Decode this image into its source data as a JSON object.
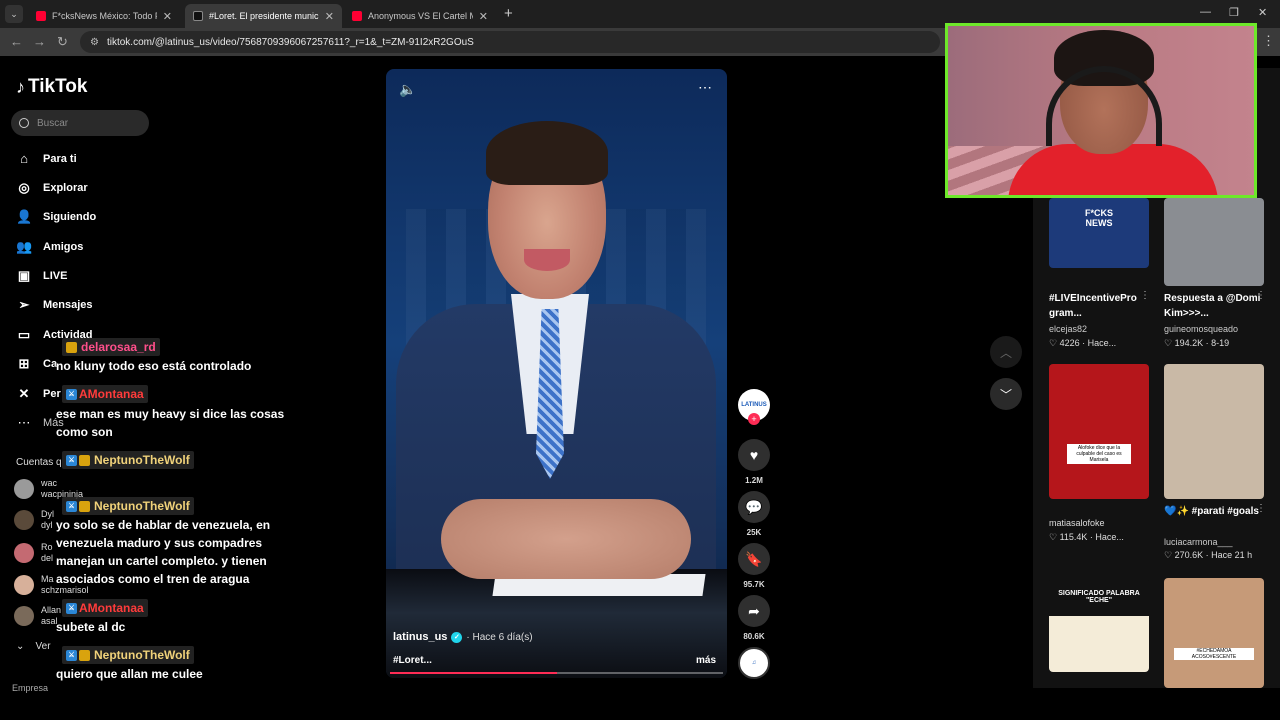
{
  "browser": {
    "tabs": [
      {
        "title": "F*cksNews México: Todo Por Un",
        "favicon_color": "#ff0033",
        "active": false
      },
      {
        "title": "#Loret. El presidente municipal",
        "favicon_color": "#111111",
        "active": true
      },
      {
        "title": "Anonymous VS El Cartel Más Pe",
        "favicon_color": "#ff0033",
        "active": false
      }
    ],
    "new_tab": "+",
    "url": "tiktok.com/@latinus_us/video/7568709396067257611?_r=1&_t=ZM-91I2xR2GOuS"
  },
  "tiktok": {
    "logo": "TikTok",
    "search_placeholder": "Buscar",
    "nav": [
      {
        "label": "Para ti",
        "icon": "home-icon"
      },
      {
        "label": "Explorar",
        "icon": "compass-icon"
      },
      {
        "label": "Siguiendo",
        "icon": "following-icon"
      },
      {
        "label": "Amigos",
        "icon": "friends-icon"
      },
      {
        "label": "LIVE",
        "icon": "live-icon"
      },
      {
        "label": "Mensajes",
        "icon": "messages-icon"
      },
      {
        "label": "Actividad",
        "icon": "activity-icon"
      },
      {
        "label": "Ca",
        "icon": "upload-icon"
      },
      {
        "label": "Per",
        "icon": "profile-icon"
      },
      {
        "label": "Más",
        "icon": "more-icon"
      }
    ],
    "accounts_title": "Cuentas q",
    "accounts": [
      {
        "name": "wac",
        "sub": "wacpininja"
      },
      {
        "name": "Dyl",
        "sub": "dyl"
      },
      {
        "name": "Ro",
        "sub": "del"
      },
      {
        "name": "Ma",
        "sub": "schzmarisol"
      },
      {
        "name": "Allan",
        "sub": "asal"
      }
    ],
    "see_more": "Ver",
    "footer": "Empresa"
  },
  "chat": [
    {
      "user": "delarosaa_rd",
      "user_color": "#ff4f8b",
      "msg": "no kluny todo eso está controlado"
    },
    {
      "user": "AMontanaa",
      "user_color": "#ff3b3b",
      "msg": "ese man es muy heavy si dice las cosas como son"
    },
    {
      "user": "NeptunoTheWolf",
      "user_color": "#f0d27a",
      "msg": ""
    },
    {
      "user": "NeptunoTheWolf",
      "user_color": "#f0d27a",
      "msg": "yo solo se de hablar de venezuela, en venezuela maduro y sus compadres manejan un cartel completo. y tienen asociados como el tren de aragua"
    },
    {
      "user": "AMontanaa",
      "user_color": "#ff3b3b",
      "msg": "subete al dc"
    },
    {
      "user": "NeptunoTheWolf",
      "user_color": "#f0d27a",
      "msg": "quiero que allan me culee"
    }
  ],
  "video": {
    "author": "latinus_us",
    "time": "· Hace 6 día(s)",
    "caption": "#Loret...",
    "more": "más",
    "progress": 0.5,
    "actions": [
      {
        "name": "like",
        "icon": "heart-icon",
        "count": "1.2M"
      },
      {
        "name": "comment",
        "icon": "comment-icon",
        "count": "25K"
      },
      {
        "name": "bookmark",
        "icon": "bookmark-icon",
        "count": "95.7K"
      },
      {
        "name": "share",
        "icon": "share-icon",
        "count": "80.6K"
      }
    ],
    "avatar_text": "LATINUS"
  },
  "right": [
    {
      "title": "#LIVEIncentivePro gram...",
      "user": "elcejas82",
      "stats": "♡ 4226 · Hace...",
      "thumb_text": "F*CKS NEWS",
      "thumb_color": "#1d3a7a"
    },
    {
      "title": "Respuesta a @Domi Kim>>>...",
      "user": "guineomosqueado",
      "stats": "♡ 194.2K · 8-19",
      "thumb_text": "",
      "thumb_color": "#8a8d92"
    },
    {
      "title": "",
      "user": "matiasalofoke",
      "stats": "♡ 115.4K · Hace...",
      "thumb_text": "Alofoke dice que la culpable del caso es Marisela",
      "thumb_color": "#b5161b"
    },
    {
      "title": "💙✨ #parati #goals",
      "user": "luciacarmona___",
      "stats": "♡ 270.6K · Hace 21 h",
      "thumb_text": "",
      "thumb_color": "#c9b9a6"
    },
    {
      "title": "",
      "user": "",
      "stats": "",
      "thumb_text": "SIGNIFICADO PALABRA \"ECHE\"",
      "thumb_color": "#f4f4f4"
    },
    {
      "title": "",
      "user": "",
      "stats": "",
      "thumb_text": "#ECHEDAMOA ACOSO#ESCENTE",
      "thumb_color": "#c69a78"
    }
  ]
}
